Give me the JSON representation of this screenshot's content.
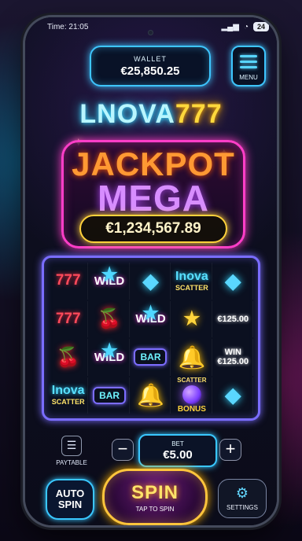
{
  "status": {
    "time": "Time: 21:05",
    "battery": "24"
  },
  "wallet": {
    "label": "WALLET",
    "amount": "€25,850.25"
  },
  "menu": {
    "label": "MENU"
  },
  "logo": {
    "part1": "LNOVA",
    "part2": "777"
  },
  "jackpot": {
    "line1": "JACKPOT",
    "line2": "MEGA",
    "amount": "€1,234,567.89"
  },
  "reels": {
    "cells": [
      [
        "777",
        "WILD",
        "GEM",
        "Inova SCATTER",
        "GEM"
      ],
      [
        "777",
        "CHERRY",
        "WILD",
        "STAR",
        "€125.00"
      ],
      [
        "CHERRY",
        "WILD",
        "BAR",
        "BELL",
        "WIN €125.00"
      ],
      [
        "Inova SCATTER",
        "BAR",
        "BELL",
        "SCATTER BONUS",
        "GEM"
      ]
    ],
    "labels": {
      "wild": "WILD",
      "bar": "BAR",
      "scatter_brand": "Inova",
      "scatter": "SCATTER",
      "bonus": "BONUS",
      "win": "WIN",
      "win_amount": "€125.00"
    }
  },
  "controls": {
    "paytable": "PAYTABLE",
    "bet_label": "BET",
    "bet_value": "€5.00",
    "minus": "−",
    "plus": "+",
    "auto_spin": "AUTO\nSPIN",
    "spin": "SPIN",
    "spin_hint": "TAP TO SPIN",
    "settings": "SETTINGS"
  },
  "icons": {
    "menu": "hamburger-icon",
    "paytable": "document-icon",
    "settings": "gear-icon",
    "wild_star": "star-icon",
    "gem": "diamond-icon",
    "cherry": "cherry-icon",
    "bell": "bell-icon",
    "bonus": "orb-icon"
  }
}
